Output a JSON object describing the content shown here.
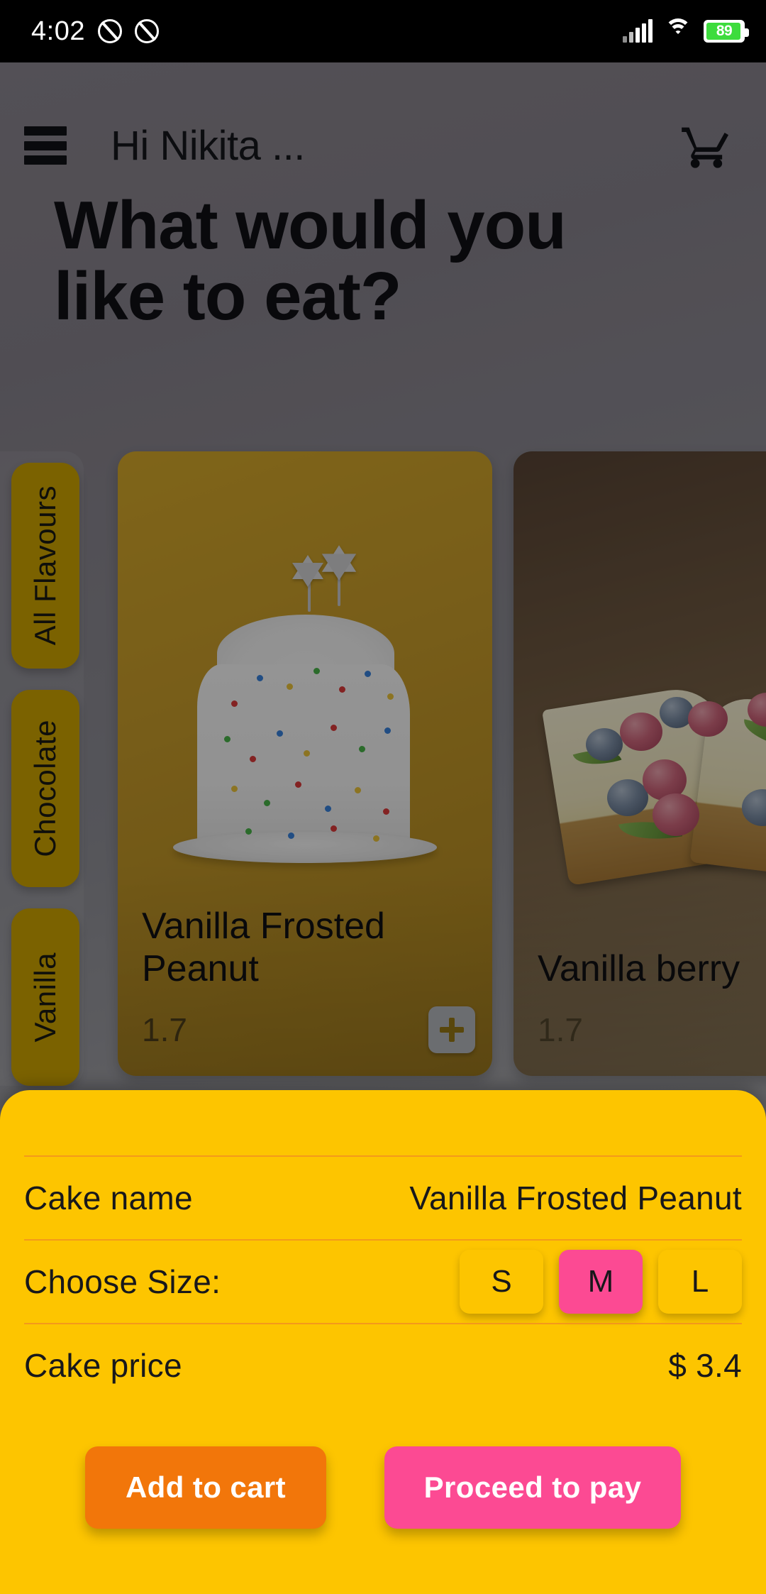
{
  "status_bar": {
    "time": "4:02",
    "battery_percent": "89",
    "icons": [
      "do-not-disturb-icon",
      "mute-icon",
      "signal-icon",
      "wifi-icon",
      "battery-icon"
    ]
  },
  "header": {
    "menu_icon": "hamburger-menu-icon",
    "greeting": "Hi Nikita ...",
    "cart_icon": "shopping-cart-icon",
    "headline": "What would you like to eat?"
  },
  "flavour_rail": {
    "items": [
      {
        "label": "All Flavours",
        "selected": true
      },
      {
        "label": "Chocolate",
        "selected": false
      },
      {
        "label": "Vanilla",
        "selected": false
      }
    ],
    "tab_color": "#d4a900"
  },
  "products": [
    {
      "name": "Vanilla Frosted Peanut",
      "price": "1.7",
      "add_icon": "plus-icon",
      "card_color": "#cda02b"
    },
    {
      "name": "Vanilla berry",
      "price": "1.7",
      "add_icon": "plus-icon",
      "card_color": "#7b6448"
    }
  ],
  "sheet": {
    "background_color": "#fdc500",
    "divider_color": "#f08a24",
    "cake_name_label": "Cake name",
    "cake_name_value": "Vanilla Frosted Peanut",
    "choose_size_label": "Choose Size:",
    "sizes": [
      {
        "label": "S",
        "selected": false
      },
      {
        "label": "M",
        "selected": true
      },
      {
        "label": "L",
        "selected": false
      }
    ],
    "selected_size_color": "#fc4a93",
    "cake_price_label": "Cake price",
    "cake_price_value": "$ 3.4",
    "add_to_cart_label": "Add to cart",
    "add_to_cart_color": "#f2760a",
    "proceed_to_pay_label": "Proceed to pay",
    "proceed_to_pay_color": "#fc4a93"
  }
}
